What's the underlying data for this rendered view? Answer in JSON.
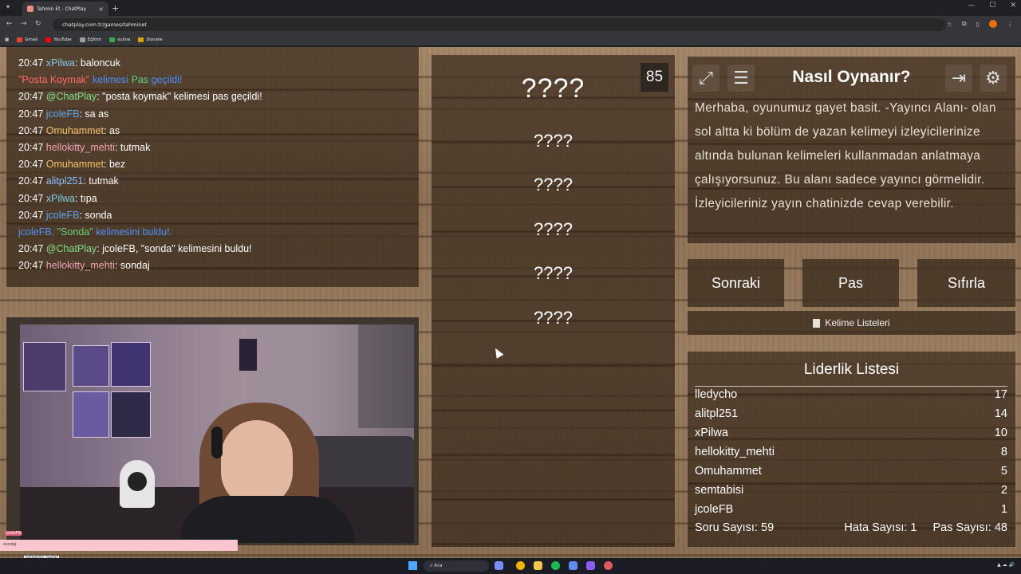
{
  "browser": {
    "tab_title": "Tahmin Et - ChatPlay",
    "tab_close": "×",
    "new_tab": "+",
    "url": "chatplay.com.tr/games/tahminet",
    "bookmarks": [
      "Gmail",
      "YouTube",
      "Eğitim",
      "sulina",
      "Donate"
    ]
  },
  "chat": {
    "lines": [
      {
        "time": "20:47",
        "user": "xPilwa",
        "msg": ": baloncuk"
      },
      {
        "sys_word": "\"Posta Koymak\"",
        "sys_mid": " kelimesi ",
        "sys_tail_a": "Pas",
        "sys_tail_b": " geçildi!"
      },
      {
        "time": "20:47",
        "user": "@ChatPlay",
        "msg": ": \"posta koymak\" kelimesi pas geçildi!"
      },
      {
        "time": "20:47",
        "user": "jcoleFB",
        "msg": ": sa as"
      },
      {
        "time": "20:47",
        "user": "Omuhammet",
        "msg": ": as"
      },
      {
        "time": "20:47",
        "user": "hellokitty_mehti",
        "msg": ": tutmak"
      },
      {
        "time": "20:47",
        "user": "Omuhammet",
        "msg": ": bez"
      },
      {
        "time": "20:47",
        "user": "alitpl251",
        "msg": ": tutmak"
      },
      {
        "time": "20:47",
        "user": "xPilwa",
        "msg": ": tıpa"
      },
      {
        "time": "20:47",
        "user": "jcoleFB",
        "msg": ": sonda"
      },
      {
        "sys_user": "jcoleFB, ",
        "sys_word": "\"Sonda\"",
        "sys_tail": " kelimesini buldu!."
      },
      {
        "time": "20:47",
        "user": "@ChatPlay",
        "msg": ": jcoleFB, \"sonda\" kelimesini buldu!"
      },
      {
        "time": "20:47",
        "user": "hellokitty_mehti",
        "msg": ": sondaj"
      }
    ]
  },
  "game": {
    "timer": "85",
    "main_word": "????",
    "forbidden_words": [
      "????",
      "????",
      "????",
      "????",
      "????"
    ]
  },
  "howto": {
    "title": "Nasıl Oynanır?",
    "text": "Merhaba, oyunumuz gayet basit. -Yayıncı Alanı- olan sol altta ki bölüm de yazan kelimeyi izleyicilerinize altında bulunan kelimeleri kullanmadan anlatmaya çalışıyorsunuz. Bu alanı sadece yayıncı görmelidir. İzleyicileriniz yayın chatinizde cevap verebilir."
  },
  "buttons": {
    "next": "Sonraki",
    "pass": "Pas",
    "reset": "Sıfırla",
    "word_lists": "Kelime Listeleri"
  },
  "leaderboard": {
    "title": "Liderlik Listesi",
    "rows": [
      {
        "name": "lledycho",
        "score": "17"
      },
      {
        "name": "alitpl251",
        "score": "14"
      },
      {
        "name": "xPilwa",
        "score": "10"
      },
      {
        "name": "hellokitty_mehti",
        "score": "8"
      },
      {
        "name": "Omuhammet",
        "score": "5"
      },
      {
        "name": "semtabisi",
        "score": "2"
      },
      {
        "name": "jcoleFB",
        "score": "1"
      }
    ],
    "question_count": "Soru Sayısı: 59",
    "error_count": "Hata Sayısı: 1",
    "pass_count": "Pas Sayısı: 48"
  },
  "stream_overlay": {
    "names": [
      "jcoleFB",
      "sondaj",
      "hellokitty_mehti"
    ]
  },
  "taskbar": {
    "search": "Ara"
  },
  "colors": {
    "wood_dark": "#3e2e20",
    "accent_orange": "#e8710a"
  }
}
